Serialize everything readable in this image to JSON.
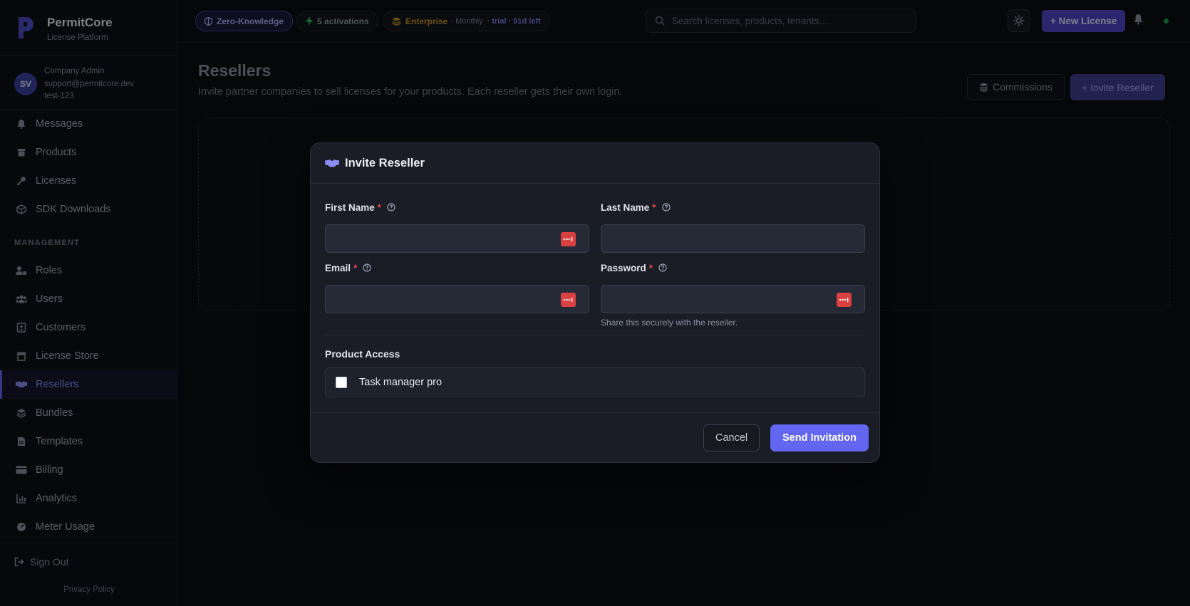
{
  "brand": {
    "name": "PermitCore",
    "subtitle": "License Platform"
  },
  "user": {
    "initials": "SV",
    "role": "Company Admin",
    "email": "support@permitcore.dev",
    "tenant": "test-123"
  },
  "sidebar": {
    "items": [
      {
        "label": "Messages",
        "icon": "bell-icon"
      },
      {
        "label": "Products",
        "icon": "box-icon"
      },
      {
        "label": "Licenses",
        "icon": "key-icon"
      },
      {
        "label": "SDK Downloads",
        "icon": "cube-icon"
      }
    ],
    "section_label": "MANAGEMENT",
    "management_items": [
      {
        "label": "Roles",
        "icon": "user-lock-icon"
      },
      {
        "label": "Users",
        "icon": "users-icon"
      },
      {
        "label": "Customers",
        "icon": "contact-card-icon"
      },
      {
        "label": "License Store",
        "icon": "store-icon"
      },
      {
        "label": "Resellers",
        "icon": "handshake-icon",
        "active": true
      },
      {
        "label": "Bundles",
        "icon": "layers-icon"
      },
      {
        "label": "Templates",
        "icon": "file-icon"
      },
      {
        "label": "Billing",
        "icon": "credit-card-icon"
      },
      {
        "label": "Analytics",
        "icon": "chart-icon"
      },
      {
        "label": "Meter Usage",
        "icon": "gauge-icon"
      }
    ],
    "sign_out": "Sign Out",
    "privacy": "Privacy Policy"
  },
  "topbar": {
    "zero_knowledge": "Zero-Knowledge",
    "activations": "5 activations",
    "plan": "Enterprise",
    "plan_cycle": "· Monthly",
    "plan_trial": "· trial · 91d left",
    "search_placeholder": "Search licenses, products, tenants...",
    "new_license": "+ New License"
  },
  "page": {
    "title": "Resellers",
    "description": "Invite partner companies to sell licenses for your products. Each reseller gets their own login.",
    "commissions_button": "Commissions",
    "invite_button": "+ Invite Reseller"
  },
  "modal": {
    "title": "Invite Reseller",
    "fields": {
      "first_name": {
        "label": "First Name",
        "required": "*",
        "value": ""
      },
      "last_name": {
        "label": "Last Name",
        "required": "*",
        "value": ""
      },
      "email": {
        "label": "Email",
        "required": "*",
        "value": ""
      },
      "password": {
        "label": "Password",
        "required": "*",
        "value": "",
        "hint": "Share this securely with the reseller."
      }
    },
    "product_access_label": "Product Access",
    "products": [
      {
        "name": "Task manager pro",
        "checked": false
      }
    ],
    "cancel": "Cancel",
    "send": "Send Invitation"
  },
  "colors": {
    "accent": "#6366f1",
    "danger": "#d94141",
    "online": "#16a34a",
    "warning": "#c89a2a"
  }
}
